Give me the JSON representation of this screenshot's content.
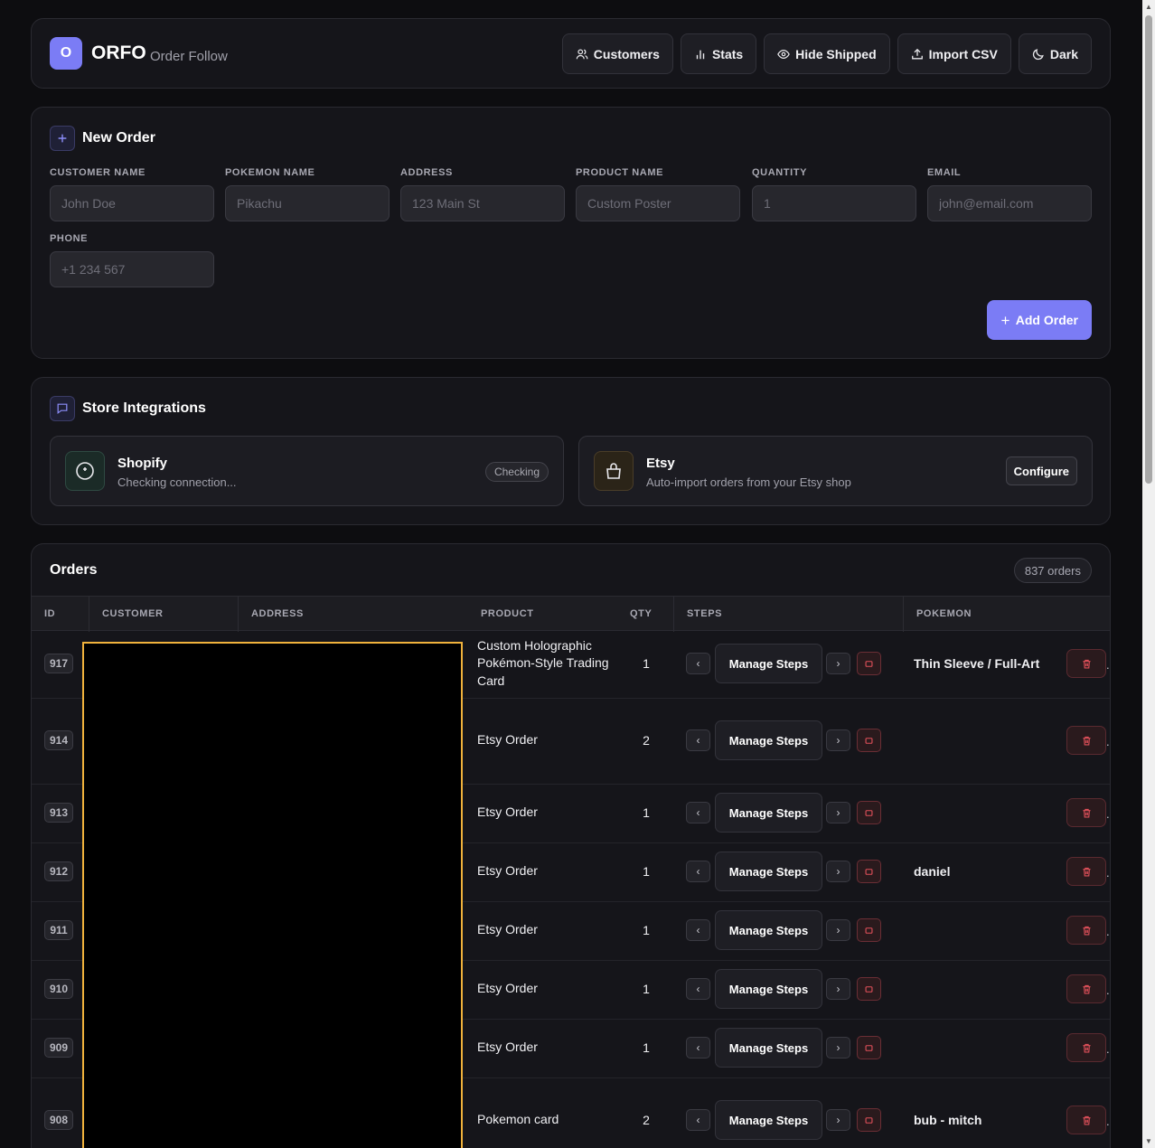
{
  "app": {
    "logo_letter": "O",
    "brand": "ORFO",
    "subtitle": "Order Follow"
  },
  "header_buttons": [
    {
      "label": "Customers",
      "icon": "users-icon"
    },
    {
      "label": "Stats",
      "icon": "bar-chart-icon"
    },
    {
      "label": "Hide Shipped",
      "icon": "eye-icon"
    },
    {
      "label": "Import CSV",
      "icon": "upload-icon"
    },
    {
      "label": "Dark",
      "icon": "moon-icon"
    }
  ],
  "new_order": {
    "title": "New Order",
    "fields": [
      {
        "label": "CUSTOMER NAME",
        "placeholder": "John Doe"
      },
      {
        "label": "POKEMON NAME",
        "placeholder": "Pikachu"
      },
      {
        "label": "ADDRESS",
        "placeholder": "123 Main St"
      },
      {
        "label": "PRODUCT NAME",
        "placeholder": "Custom Poster"
      },
      {
        "label": "QUANTITY",
        "placeholder": "1"
      },
      {
        "label": "EMAIL",
        "placeholder": "john@email.com"
      },
      {
        "label": "PHONE",
        "placeholder": "+1 234 567"
      }
    ],
    "add_button": "Add Order"
  },
  "integrations": {
    "title": "Store Integrations",
    "shopify": {
      "name": "Shopify",
      "description": "Checking connection...",
      "status": "Checking"
    },
    "etsy": {
      "name": "Etsy",
      "description": "Auto-import orders from your Etsy shop",
      "action": "Configure"
    }
  },
  "orders": {
    "title": "Orders",
    "count": "837 orders",
    "columns": [
      "ID",
      "CUSTOMER",
      "ADDRESS",
      "PRODUCT",
      "QTY",
      "STEPS",
      "POKEMON"
    ],
    "manage_label": "Manage Steps",
    "prev_glyph": "‹",
    "next_glyph": "›",
    "overflow": "..",
    "rows": [
      {
        "id": "917",
        "product": "Custom Holographic Pokémon-Style Trading Card",
        "qty": "1",
        "pokemon": "Thin Sleeve / Full-Art"
      },
      {
        "id": "914",
        "product": "Etsy Order",
        "qty": "2",
        "pokemon": ""
      },
      {
        "id": "913",
        "product": "Etsy Order",
        "qty": "1",
        "pokemon": ""
      },
      {
        "id": "912",
        "product": "Etsy Order",
        "qty": "1",
        "pokemon": "daniel"
      },
      {
        "id": "911",
        "product": "Etsy Order",
        "qty": "1",
        "pokemon": ""
      },
      {
        "id": "910",
        "product": "Etsy Order",
        "qty": "1",
        "pokemon": ""
      },
      {
        "id": "909",
        "product": "Etsy Order",
        "qty": "1",
        "pokemon": ""
      },
      {
        "id": "908",
        "product": "Pokemon card",
        "qty": "2",
        "pokemon": "bub - mitch"
      }
    ]
  },
  "colors": {
    "accent": "#7b7cf5",
    "danger": "#e0505a",
    "redact_border": "#f0b23c"
  }
}
